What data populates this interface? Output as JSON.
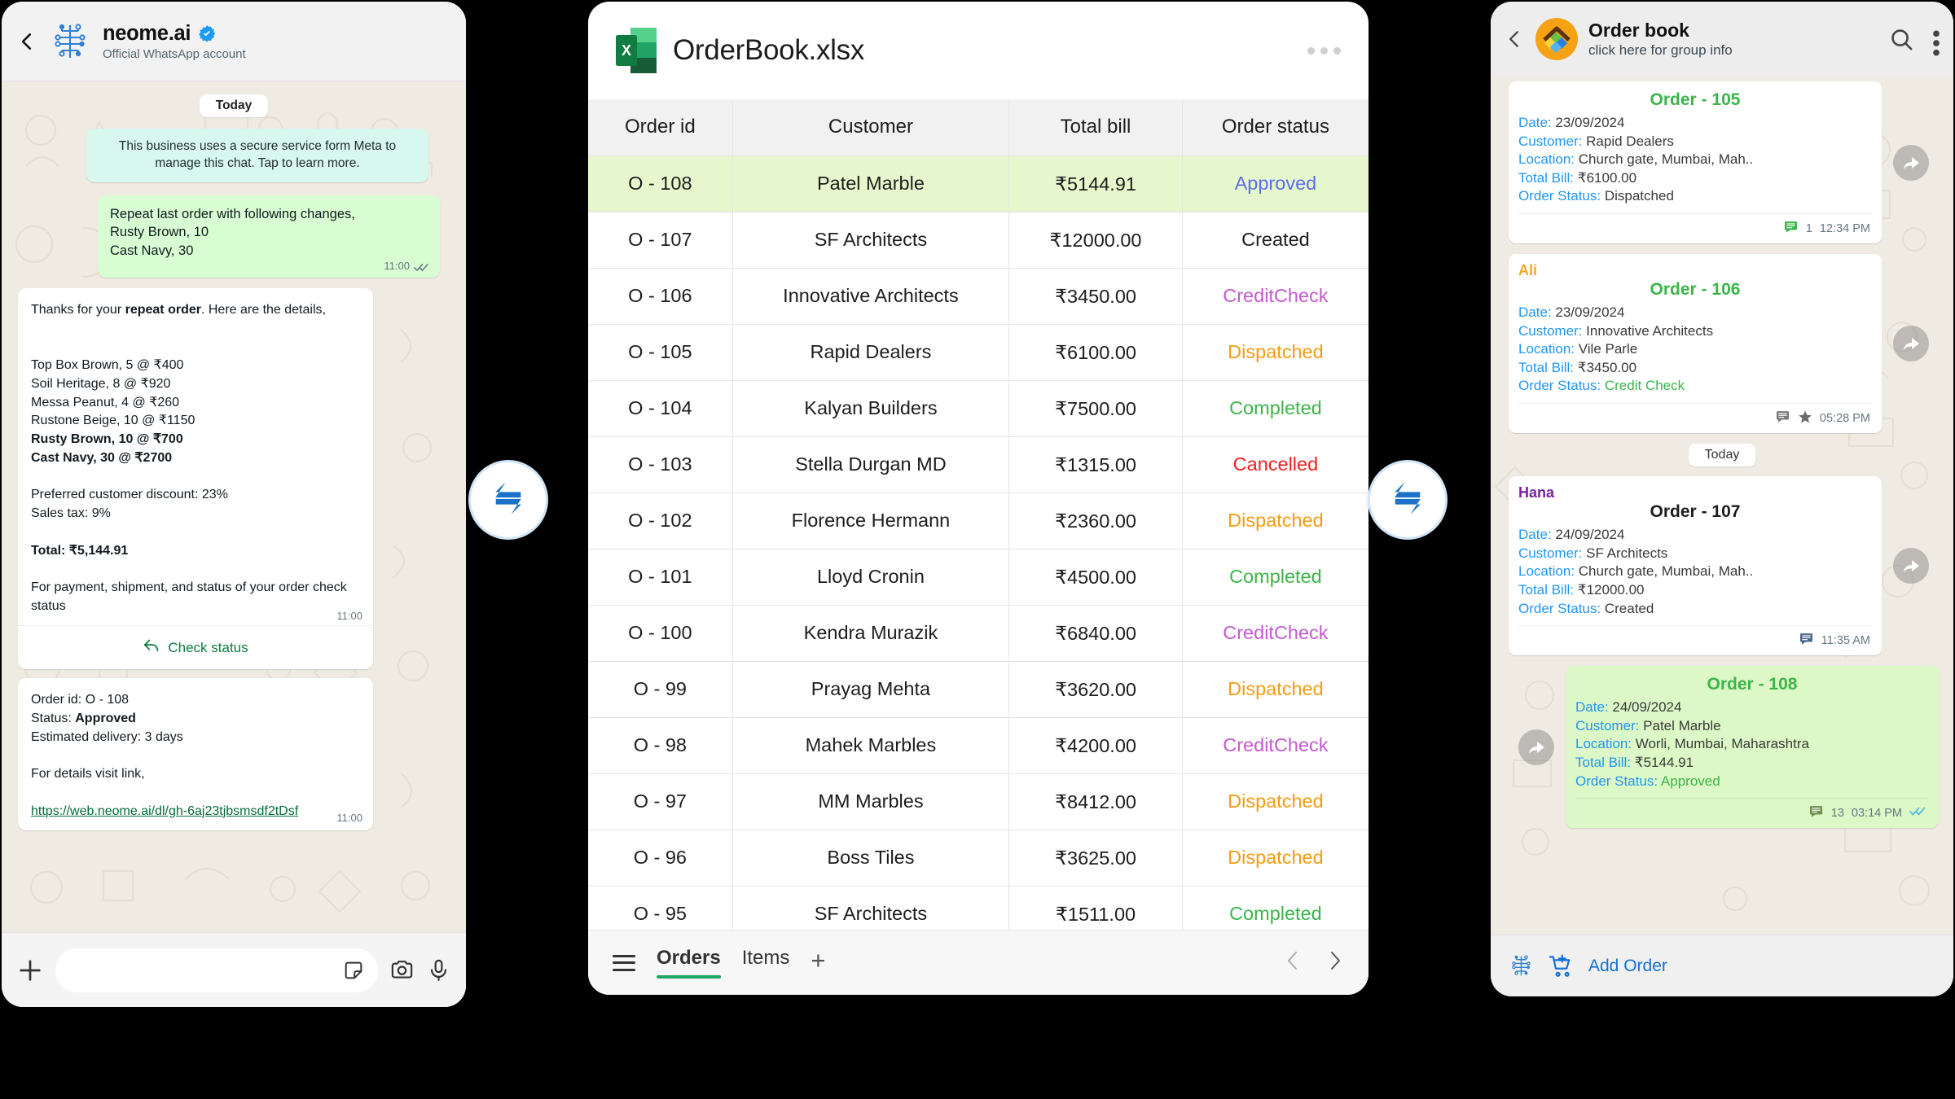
{
  "whatsapp": {
    "header": {
      "name": "neome.ai",
      "subtitle": "Official WhatsApp account",
      "back_icon": "back-chevron-icon",
      "verified_icon": "verified-badge-icon"
    },
    "day_chip": "Today",
    "system_message": "This business uses a secure service form Meta to manage this chat. Tap to learn more.",
    "outgoing_message": "Repeat last order with following changes,\nRusty Brown, 10\nCast Navy, 30",
    "outgoing_time": "11:00",
    "reply_intro_a": "Thanks for your ",
    "reply_intro_b": "repeat order",
    "reply_intro_c": ". Here are the details,",
    "items": [
      {
        "text": "Top Box Brown, 5 @ ₹400",
        "bold": false
      },
      {
        "text": "Soil Heritage, 8 @ ₹920",
        "bold": false
      },
      {
        "text": "Messa Peanut, 4 @ ₹260",
        "bold": false
      },
      {
        "text": "Rustone Beige, 10 @ ₹1150",
        "bold": false
      },
      {
        "text": "Rusty Brown, 10 @ ₹700",
        "bold": true
      },
      {
        "text": "Cast Navy, 30 @ ₹2700",
        "bold": true
      }
    ],
    "discount_line": "Preferred customer discount: 23%",
    "tax_line": "Sales tax: 9%",
    "total_line": "Total: ₹5,144.91",
    "footer_note": "For payment, shipment, and status of your order check status",
    "reply_time": "11:00",
    "cta_label": "Check status",
    "cta_icon": "reply-arrow-icon",
    "status_card": {
      "order_id_line": "Order id: O - 108",
      "status_label": "Status: ",
      "status_value": "Approved",
      "delivery_line": "Estimated delivery: 3 days",
      "details_line": "For details visit link,",
      "link": "https://web.neome.ai/dl/gh-6aj23tjbsmsdf2tDsf",
      "time": "11:00"
    },
    "composer": {
      "placeholder": "",
      "plus_icon": "plus-icon",
      "sticker_icon": "sticker-icon",
      "camera_icon": "camera-icon",
      "mic_icon": "microphone-icon"
    }
  },
  "excel": {
    "filename": "OrderBook.xlsx",
    "app_icon": "excel-file-icon",
    "more_icon": "more-options-icon",
    "tabs": [
      {
        "label": "Orders",
        "active": true
      },
      {
        "label": "Items",
        "active": false
      }
    ],
    "add_sheet_icon": "add-sheet-icon",
    "menu_icon": "hamburger-menu-icon",
    "prev_icon": "chevron-left-icon",
    "next_icon": "chevron-right-icon",
    "status_colors": {
      "Approved": "#5b6ee8",
      "Created": "#1d1d1d",
      "CreditCheck": "#c45ad0",
      "Dispatched": "#f59c13",
      "Completed": "#3bb54a",
      "Cancelled": "#f5201f"
    }
  },
  "chart_data": {
    "type": "table",
    "title": "OrderBook.xlsx — Orders",
    "columns": [
      "Order id",
      "Customer",
      "Total bill",
      "Order status"
    ],
    "rows": [
      [
        "O - 108",
        "Patel Marble",
        "₹5144.91",
        "Approved"
      ],
      [
        "O - 107",
        "SF Architects",
        "₹12000.00",
        "Created"
      ],
      [
        "O - 106",
        "Innovative Architects",
        "₹3450.00",
        "CreditCheck"
      ],
      [
        "O - 105",
        "Rapid Dealers",
        "₹6100.00",
        "Dispatched"
      ],
      [
        "O - 104",
        "Kalyan Builders",
        "₹7500.00",
        "Completed"
      ],
      [
        "O - 103",
        "Stella Durgan MD",
        "₹1315.00",
        "Cancelled"
      ],
      [
        "O - 102",
        "Florence Hermann",
        "₹2360.00",
        "Dispatched"
      ],
      [
        "O - 101",
        "Lloyd Cronin",
        "₹4500.00",
        "Completed"
      ],
      [
        "O - 100",
        "Kendra Murazik",
        "₹6840.00",
        "CreditCheck"
      ],
      [
        "O - 99",
        "Prayag Mehta",
        "₹3620.00",
        "Dispatched"
      ],
      [
        "O - 98",
        "Mahek Marbles",
        "₹4200.00",
        "CreditCheck"
      ],
      [
        "O - 97",
        "MM Marbles",
        "₹8412.00",
        "Dispatched"
      ],
      [
        "O - 96",
        "Boss Tiles",
        "₹3625.00",
        "Dispatched"
      ],
      [
        "O - 95",
        "SF Architects",
        "₹1511.00",
        "Completed"
      ]
    ],
    "highlighted_row_index": 0
  },
  "orderbook": {
    "header": {
      "title": "Order book",
      "subtitle": "click here for group info",
      "back_icon": "back-chevron-icon",
      "avatar_icon": "group-avatar-icon",
      "search_icon": "search-icon",
      "menu_icon": "overflow-menu-icon"
    },
    "day_chip": "Today",
    "messages": [
      {
        "sender": "",
        "sender_color": "",
        "title": "Order - 105",
        "title_color": "#3bb54a",
        "date": "23/09/2024",
        "customer": "Rapid Dealers",
        "location": "Church gate, Mumbai, Mah..",
        "total_bill": "₹6100.00",
        "status": "Dispatched",
        "status_color": "#3a3a3a",
        "comment_count": "1",
        "comment_color": "#3bb54a",
        "starred": false,
        "time": "12:34 PM",
        "outgoing": false
      },
      {
        "sender": "Ali",
        "sender_color": "#f5a623",
        "title": "Order - 106",
        "title_color": "#3bb54a",
        "date": "23/09/2024",
        "customer": "Innovative Architects",
        "location": "Vile Parle",
        "total_bill": "₹3450.00",
        "status": "Credit Check",
        "status_color": "#3bb54a",
        "comment_count": "",
        "comment_color": "#7a7a7a",
        "starred": true,
        "time": "05:28 PM",
        "outgoing": false
      },
      {
        "sender": "Hana",
        "sender_color": "#7b1fa2",
        "title": "Order - 107",
        "title_color": "#1d1d1d",
        "date": "24/09/2024",
        "customer": "SF Architects",
        "location": "Church gate, Mumbai, Mah..",
        "total_bill": "₹12000.00",
        "status": "Created",
        "status_color": "#3a3a3a",
        "comment_count": "",
        "comment_color": "#4a6a8a",
        "starred": false,
        "time": "11:35 AM",
        "outgoing": false
      },
      {
        "sender": "",
        "sender_color": "",
        "title": "Order - 108",
        "title_color": "#3bb54a",
        "date": "24/09/2024",
        "customer": "Patel Marble",
        "location": "Worli, Mumbai, Maharashtra",
        "total_bill": "₹5144.91",
        "status": "Approved",
        "status_color": "#3bb54a",
        "comment_count": "13",
        "comment_color": "#6f8f4f",
        "starred": false,
        "time": "03:14 PM",
        "outgoing": true
      }
    ],
    "labels": {
      "date": "Date:",
      "customer": "Customer:",
      "location": "Location:",
      "total_bill": "Total Bill:",
      "order_status": "Order Status:"
    },
    "footer": {
      "brand_icon": "neome-logo-icon",
      "cart_icon": "add-to-cart-icon",
      "add_order_label": "Add Order"
    }
  },
  "sync_badges": {
    "icon": "sync-exchange-icon",
    "color": "#1a73c8"
  }
}
